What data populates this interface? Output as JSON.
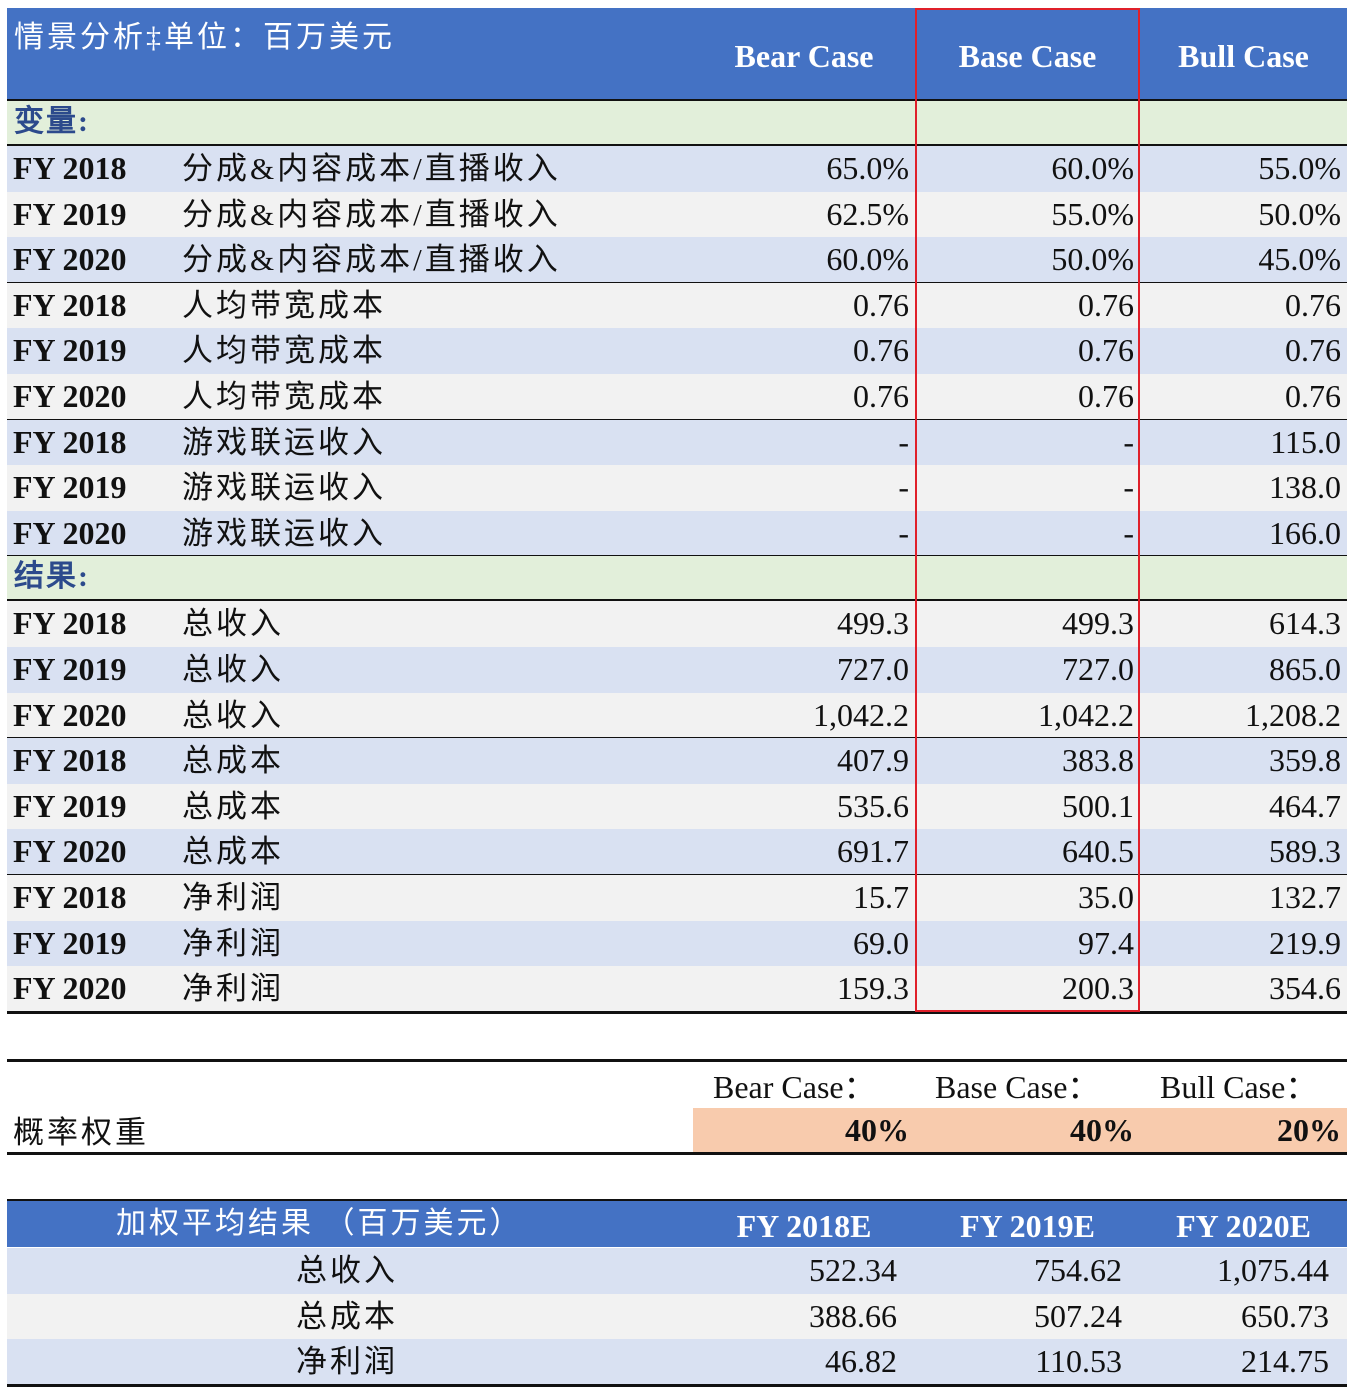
{
  "main_table": {
    "title": "情景分析‡单位：百万美元",
    "columns": [
      "Bear Case",
      "Base Case",
      "Bull Case"
    ],
    "sections": [
      {
        "label": "变量:",
        "groups": [
          {
            "rows": [
              {
                "year": "FY 2018",
                "item": "分成&内容成本/直播收入",
                "values": [
                  "65.0%",
                  "60.0%",
                  "55.0%"
                ]
              },
              {
                "year": "FY 2019",
                "item": "分成&内容成本/直播收入",
                "values": [
                  "62.5%",
                  "55.0%",
                  "50.0%"
                ]
              },
              {
                "year": "FY 2020",
                "item": "分成&内容成本/直播收入",
                "values": [
                  "60.0%",
                  "50.0%",
                  "45.0%"
                ]
              }
            ]
          },
          {
            "rows": [
              {
                "year": "FY 2018",
                "item": "人均带宽成本",
                "values": [
                  "0.76",
                  "0.76",
                  "0.76"
                ]
              },
              {
                "year": "FY 2019",
                "item": "人均带宽成本",
                "values": [
                  "0.76",
                  "0.76",
                  "0.76"
                ]
              },
              {
                "year": "FY 2020",
                "item": "人均带宽成本",
                "values": [
                  "0.76",
                  "0.76",
                  "0.76"
                ]
              }
            ]
          },
          {
            "rows": [
              {
                "year": "FY 2018",
                "item": "游戏联运收入",
                "values": [
                  "-",
                  "-",
                  "115.0"
                ]
              },
              {
                "year": "FY 2019",
                "item": "游戏联运收入",
                "values": [
                  "-",
                  "-",
                  "138.0"
                ]
              },
              {
                "year": "FY 2020",
                "item": "游戏联运收入",
                "values": [
                  "-",
                  "-",
                  "166.0"
                ]
              }
            ]
          }
        ]
      },
      {
        "label": "结果:",
        "groups": [
          {
            "rows": [
              {
                "year": "FY 2018",
                "item": "总收入",
                "values": [
                  "499.3",
                  "499.3",
                  "614.3"
                ]
              },
              {
                "year": "FY 2019",
                "item": "总收入",
                "values": [
                  "727.0",
                  "727.0",
                  "865.0"
                ]
              },
              {
                "year": "FY 2020",
                "item": "总收入",
                "values": [
                  "1,042.2",
                  "1,042.2",
                  "1,208.2"
                ]
              }
            ]
          },
          {
            "rows": [
              {
                "year": "FY 2018",
                "item": "总成本",
                "values": [
                  "407.9",
                  "383.8",
                  "359.8"
                ]
              },
              {
                "year": "FY 2019",
                "item": "总成本",
                "values": [
                  "535.6",
                  "500.1",
                  "464.7"
                ]
              },
              {
                "year": "FY 2020",
                "item": "总成本",
                "values": [
                  "691.7",
                  "640.5",
                  "589.3"
                ]
              }
            ]
          },
          {
            "rows": [
              {
                "year": "FY 2018",
                "item": "净利润",
                "values": [
                  "15.7",
                  "35.0",
                  "132.7"
                ]
              },
              {
                "year": "FY 2019",
                "item": "净利润",
                "values": [
                  "69.0",
                  "97.4",
                  "219.9"
                ]
              },
              {
                "year": "FY 2020",
                "item": "净利润",
                "values": [
                  "159.3",
                  "200.3",
                  "354.6"
                ]
              }
            ]
          }
        ]
      }
    ]
  },
  "weights": {
    "label": "概率权重",
    "headers": [
      "Bear Case：",
      "Base Case：",
      "Bull Case："
    ],
    "values": [
      "40%",
      "40%",
      "20%"
    ]
  },
  "weighted": {
    "title": "加权平均结果 （百万美元）",
    "columns": [
      "FY 2018E",
      "FY 2019E",
      "FY 2020E"
    ],
    "rows": [
      {
        "item": "总收入",
        "values": [
          "522.34",
          "754.62",
          "1,075.44"
        ]
      },
      {
        "item": "总成本",
        "values": [
          "388.66",
          "507.24",
          "650.73"
        ]
      },
      {
        "item": "净利润",
        "values": [
          "46.82",
          "110.53",
          "214.75"
        ]
      }
    ]
  },
  "colors": {
    "header_blue": "#4472c4",
    "band_blue": "#d9e1f2",
    "band_gray": "#f2f2f2",
    "section_green": "#e2efda",
    "highlight_red": "#e0202a",
    "weight_peach": "#f8cbad"
  }
}
